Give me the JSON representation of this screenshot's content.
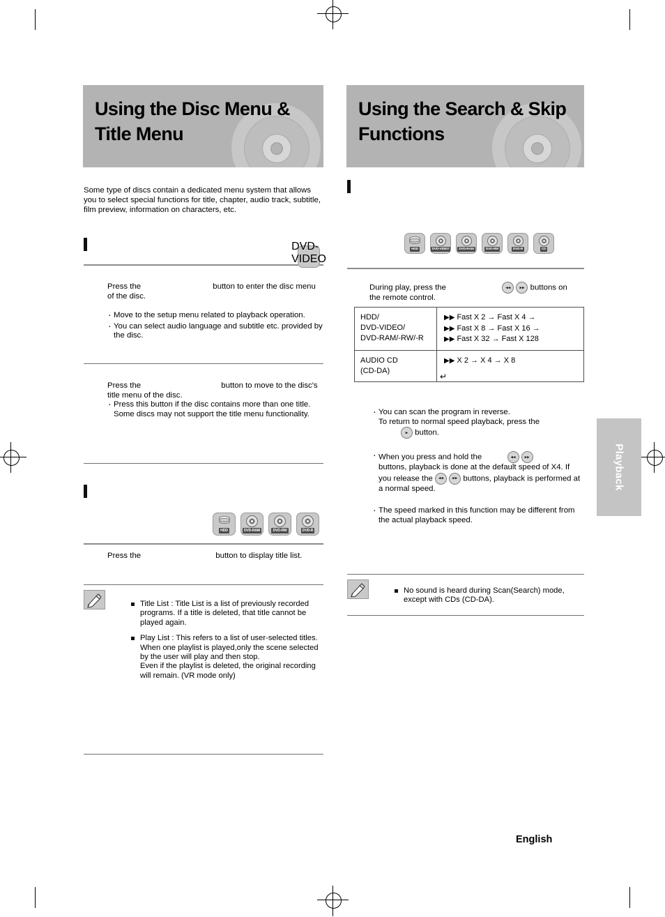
{
  "left": {
    "title": "Using the Disc Menu & Title Menu",
    "intro": "Some type of discs contain a dedicated menu system that allows you to select special functions for title, chapter, audio track, subtitle, film preview, information on characters, etc.",
    "disc_menu": {
      "chip_label": "DVD-VIDEO",
      "line1_a": "Press the",
      "line1_b": "button to enter the disc menu",
      "line2": "of the disc.",
      "bullets": [
        "Move to the setup menu related to playback operation.",
        "You can select audio language and subtitle etc. provided by the disc."
      ]
    },
    "title_menu": {
      "line1_a": "Press the",
      "line1_b": "button to move to the disc's",
      "line2": "title menu of the disc.",
      "bullets": [
        "Press this button if the disc contains more than one title. Some discs may not support the title menu functionality."
      ]
    },
    "title_list": {
      "chips": [
        "HDD",
        "DVD-RAM",
        "DVD-RW",
        "DVD-R"
      ],
      "line_a": "Press the",
      "line_b": "button to display title list."
    },
    "note": {
      "items": [
        "Title List : Title List is a list of previously recorded programs. If a title is deleted, that title cannot be played again.",
        "Play List : This refers to a list of user-selected titles. When one playlist is played,only the scene selected by the user will play and then stop.\nEven if the playlist is deleted, the original recording will remain. (VR mode only)"
      ]
    }
  },
  "right": {
    "title": "Using the Search & Skip Functions",
    "chips": [
      "HDD",
      "DVD-VIDEO",
      "DVD-RAM",
      "DVD-RW",
      "DVD-R",
      "CD"
    ],
    "intro_a": "During play, press the",
    "intro_b": "buttons on",
    "intro_c": "the remote control.",
    "table": {
      "rows": [
        {
          "label": "HDD/\nDVD-VIDEO/\nDVD-RAM/-RW/-R",
          "lines": [
            "Fast X 2 →   Fast X 4 →",
            "Fast X 8 →   Fast X 16 →",
            "Fast X 32 →   Fast X 128"
          ]
        },
        {
          "label": "AUDIO CD\n(CD-DA)",
          "lines": [
            "X 2 →    X 4 →    X 8"
          ]
        }
      ]
    },
    "bullets": [
      "You can scan the program in reverse.\nTo return to normal speed playback, press the\n     button.",
      "When you press and hold the          \nbuttons, playback is done at the default speed of X4. If you release the            buttons, playback is performed at a normal speed.",
      "The speed marked in this function may be different from the actual playback speed."
    ],
    "note": {
      "items": [
        "No sound is heard during Scan(Search) mode, except with CDs (CD-DA)."
      ]
    }
  },
  "sidetab": {
    "label": "Playback"
  },
  "footer": {
    "language": "English"
  },
  "icons": {
    "pencil": "pencil-icon",
    "rew": "rewind-icon",
    "ff": "fast-forward-icon",
    "play": "play-icon"
  }
}
